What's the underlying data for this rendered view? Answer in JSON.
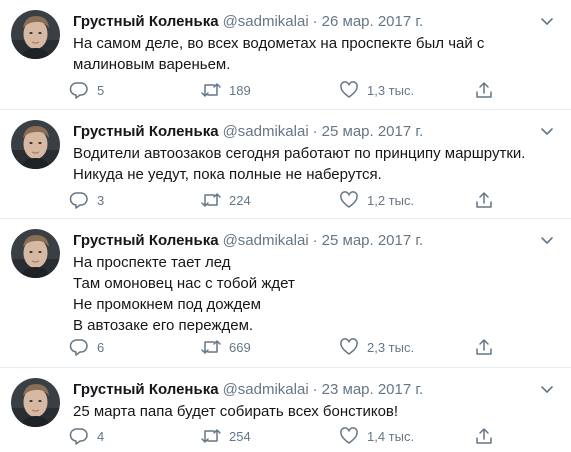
{
  "tweets": [
    {
      "name": "Грустный Коленька",
      "handle": "@sadmikalai",
      "separator": "·",
      "date": "26 мар. 2017 г.",
      "text": "На самом деле, во всех водометах на проспекте был чай с малиновым вареньем.",
      "replies": "5",
      "retweets": "189",
      "likes": "1,3 тыс."
    },
    {
      "name": "Грустный Коленька",
      "handle": "@sadmikalai",
      "separator": "·",
      "date": "25 мар. 2017 г.",
      "text": "Водители автоозаков сегодня  работают по принципу маршрутки.\nНикуда не уедут, пока полные не наберутся.",
      "replies": "3",
      "retweets": "224",
      "likes": "1,2 тыс."
    },
    {
      "name": "Грустный Коленька",
      "handle": "@sadmikalai",
      "separator": "·",
      "date": "25 мар. 2017 г.",
      "text": "На проспекте тает лед\nТам омоновец нас с тобой ждет\nНе промокнем под дождем\nВ автозаке его переждем.",
      "replies": "6",
      "retweets": "669",
      "likes": "2,3 тыс."
    },
    {
      "name": "Грустный Коленька",
      "handle": "@sadmikalai",
      "separator": "·",
      "date": "23 мар. 2017 г.",
      "text": "25 марта папа будет собирать всех бонстиков!",
      "replies": "4",
      "retweets": "254",
      "likes": "1,4 тыс."
    }
  ],
  "colors": {
    "text": "#14171a",
    "muted": "#657786",
    "divider": "#e6ecf0"
  },
  "icons": [
    "reply-icon",
    "retweet-icon",
    "like-icon",
    "share-icon",
    "caret-down-icon"
  ]
}
